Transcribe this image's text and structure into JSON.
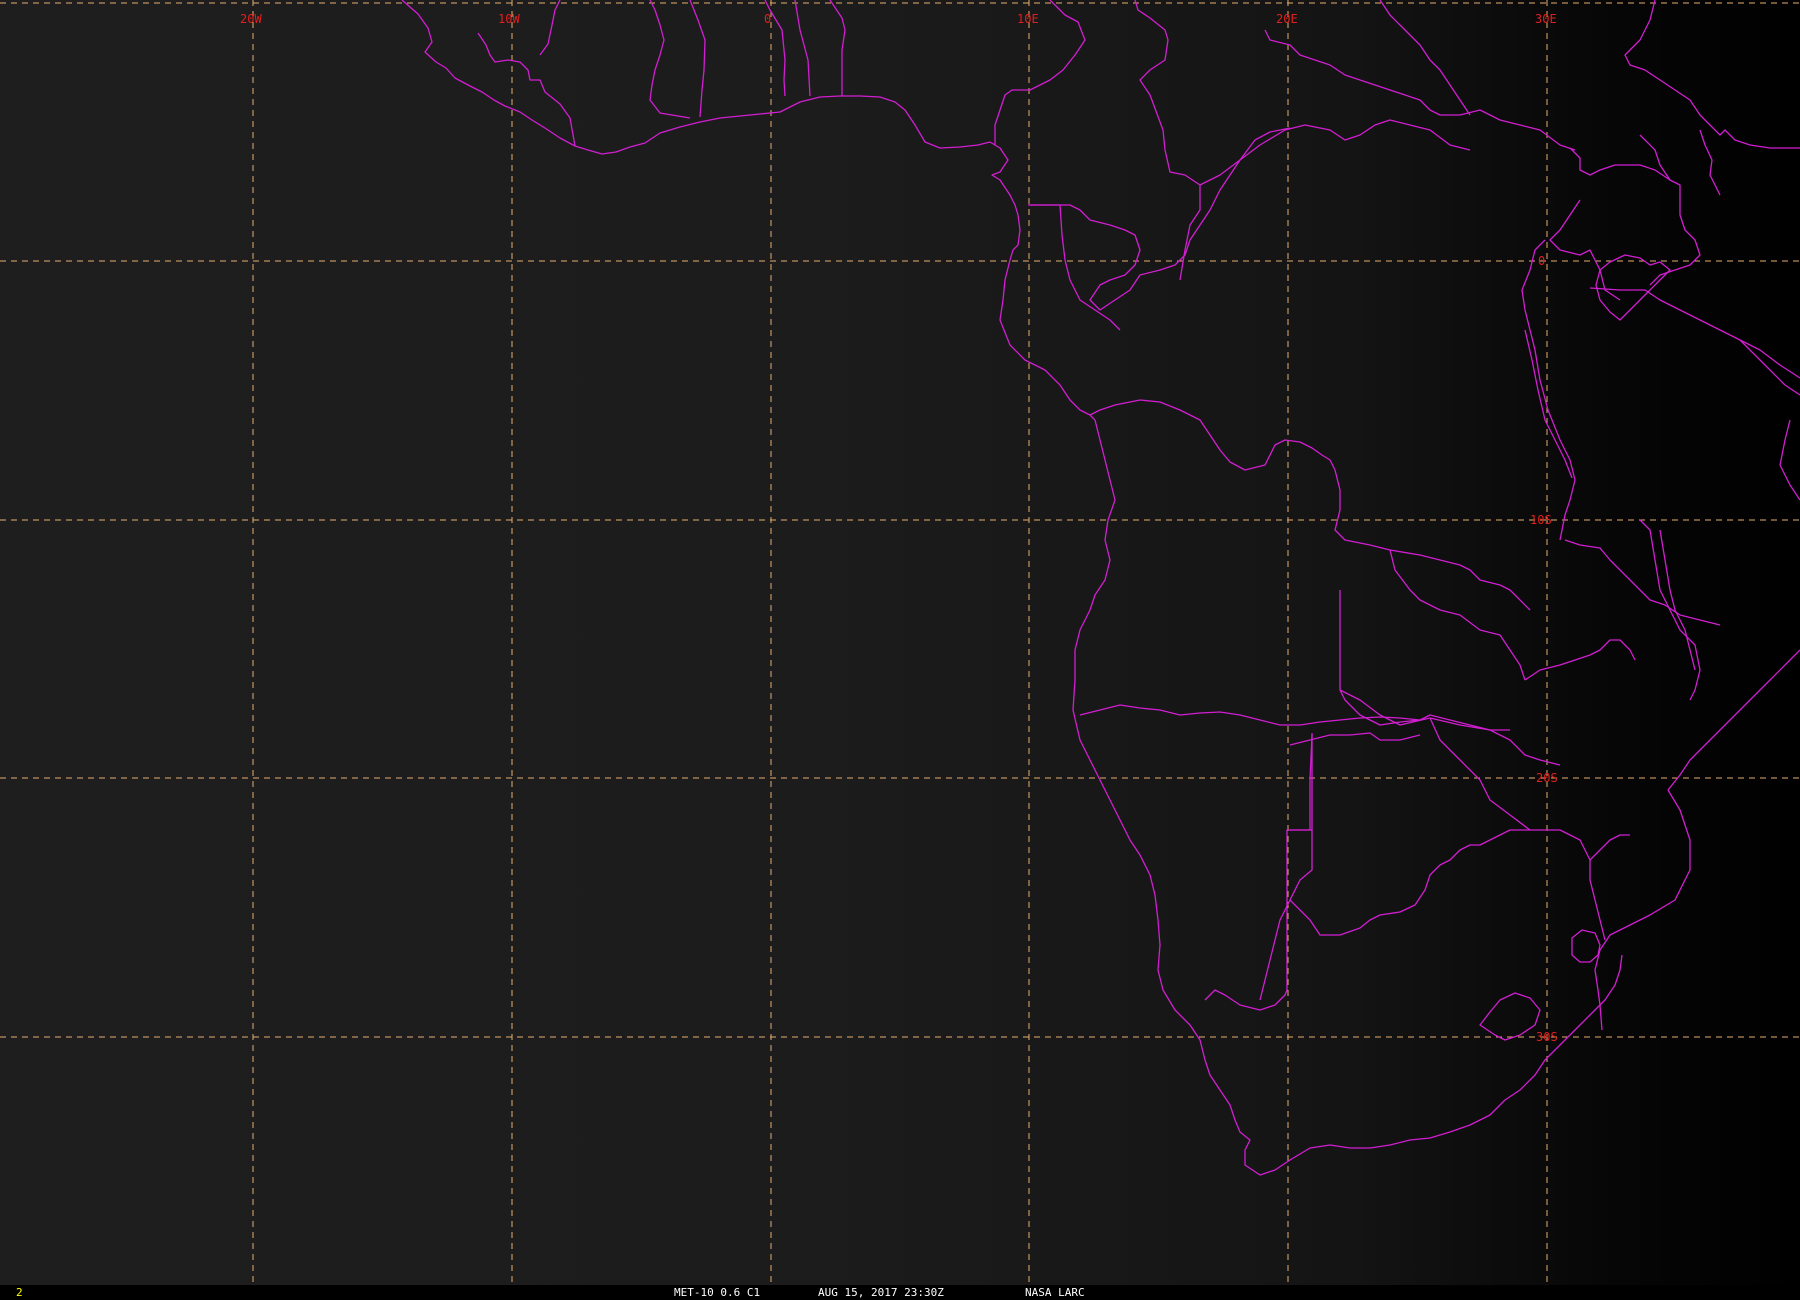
{
  "map": {
    "colors": {
      "background": "#1c1c1c",
      "coastline": "#d21ed2",
      "graticule": "#e6ad6e",
      "grid_label": "#e0201e",
      "status_text": "#ffffff",
      "frame_number": "#ffff00"
    },
    "longitude_labels": [
      "20W",
      "10W",
      "0",
      "10E",
      "20E",
      "30E"
    ],
    "latitude_labels": [
      "0",
      "10S",
      "20S",
      "30S"
    ]
  },
  "status": {
    "frame": "2",
    "product": "MET-10 0.6 C1",
    "datetime": "AUG 15, 2017 23:30Z",
    "source": "NASA LARC"
  }
}
